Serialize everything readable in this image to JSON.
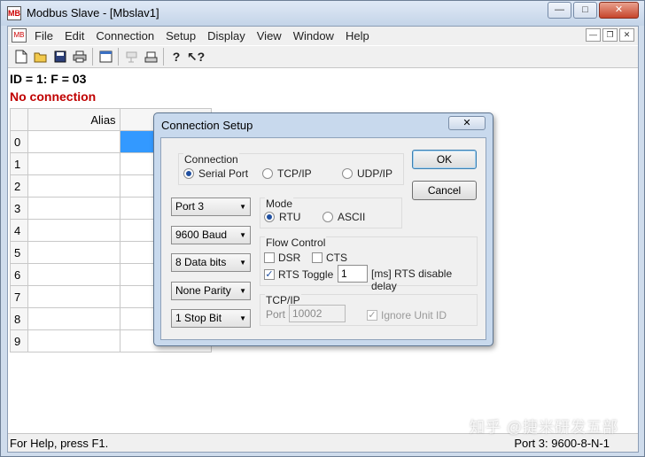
{
  "window": {
    "title": "Modbus Slave - [Mbslav1]",
    "minimize": "—",
    "maximize": "□",
    "close": "✕"
  },
  "menu": {
    "items": [
      "File",
      "Edit",
      "Connection",
      "Setup",
      "Display",
      "View",
      "Window",
      "Help"
    ],
    "mdi_minimize": "—",
    "mdi_restore": "❐",
    "mdi_close": "✕"
  },
  "toolbar": {
    "icons": [
      "new-icon",
      "open-icon",
      "save-icon",
      "print-icon",
      "window-icon",
      "connect-icon",
      "disconnect-icon",
      "about-icon",
      "context-help-icon"
    ]
  },
  "info": {
    "id_line": "ID = 1: F = 03",
    "connection_status": "No connection"
  },
  "grid": {
    "header_alias": "Alias",
    "rows": [
      "0",
      "1",
      "2",
      "3",
      "4",
      "5",
      "6",
      "7",
      "8",
      "9"
    ]
  },
  "status": {
    "left": "For Help, press F1.",
    "right": "Port 3: 9600-8-N-1",
    "watermark": "知乎 @捷米研发五部"
  },
  "dialog": {
    "title": "Connection Setup",
    "close_symbol": "✕",
    "connection_group": "Connection",
    "connection_options": [
      "Serial Port",
      "TCP/IP",
      "UDP/IP"
    ],
    "connection_selected": "Serial Port",
    "ok_label": "OK",
    "cancel_label": "Cancel",
    "port": "Port 3",
    "baud": "9600 Baud",
    "data_bits": "8 Data bits",
    "parity": "None Parity",
    "stop_bits": "1 Stop Bit",
    "mode_group": "Mode",
    "mode_options": [
      "RTU",
      "ASCII"
    ],
    "mode_selected": "RTU",
    "flow_group": "Flow Control",
    "dsr_label": "DSR",
    "cts_label": "CTS",
    "rts_toggle_label": "RTS Toggle",
    "rts_delay_value": "1",
    "rts_delay_label": "[ms] RTS disable delay",
    "tcp_group": "TCP/IP",
    "port_label": "Port",
    "port_value": "10002",
    "ignore_unit_label": "Ignore Unit ID"
  }
}
